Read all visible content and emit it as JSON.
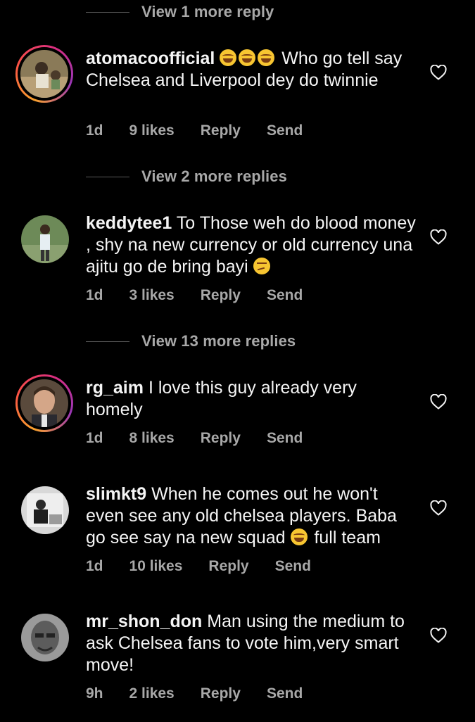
{
  "view_replies": [
    {
      "label": "View 1 more reply"
    },
    {
      "label": "View 2 more replies"
    },
    {
      "label": "View 13 more replies"
    }
  ],
  "comments": [
    {
      "username": "atomacoofficial",
      "emojis": "😂😂😂",
      "text": "Who go tell say Chelsea and Liverpool dey do twinnie",
      "time": "1d",
      "likes": "9 likes",
      "reply": "Reply",
      "send": "Send"
    },
    {
      "username": "keddytee1",
      "text": "To Those weh do blood money , shy na new currency or old currency una ajitu go de bring bayi",
      "emoji_end": "🤔",
      "time": "1d",
      "likes": "3 likes",
      "reply": "Reply",
      "send": "Send"
    },
    {
      "username": "rg_aim",
      "text": "I love this guy already very homely",
      "time": "1d",
      "likes": "8 likes",
      "reply": "Reply",
      "send": "Send"
    },
    {
      "username": "slimkt9",
      "text": "When he comes out he won't even see any old chelsea players. Baba go see say na new squad",
      "emoji_mid": "😂",
      "text_after": "full team",
      "time": "1d",
      "likes": "10 likes",
      "reply": "Reply",
      "send": "Send"
    },
    {
      "username": "mr_shon_don",
      "text": "Man using the medium to ask Chelsea fans to vote him,very smart move!",
      "time": "9h",
      "likes": "2 likes",
      "reply": "Reply",
      "send": "Send"
    }
  ],
  "colors": {
    "background": "#000000",
    "text": "#f5f5f5",
    "muted": "#a8a8a8",
    "story_ring": "#d92e7f"
  }
}
